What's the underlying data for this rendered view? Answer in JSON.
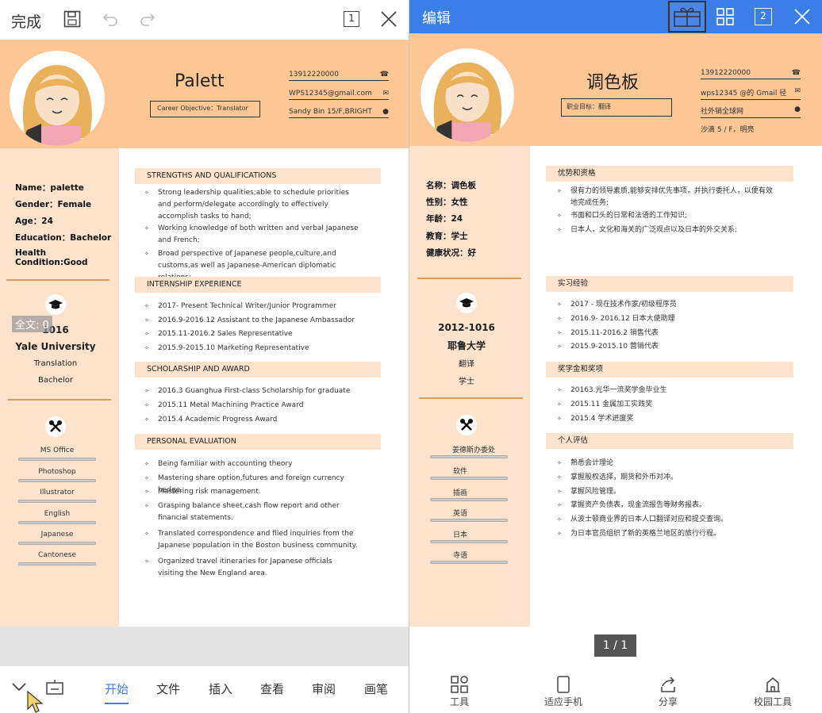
{
  "left": {
    "toolbar": {
      "done": "完成",
      "page_badge": "1"
    },
    "resume": {
      "name": "Palett",
      "objective": "Career Objective：Translator",
      "phone": "13912220000",
      "email": "WPS12345@gmail.com",
      "address": "Sandy Bin 15/F,BRIGHT",
      "info": [
        "Name：palette",
        "Gender：Female",
        "Age：24",
        "Education：Bachelor",
        "Health Condition:Good"
      ],
      "edu": {
        "years": "1016",
        "school": "Yale University",
        "major": "Translation",
        "degree": "Bachelor"
      },
      "skills": [
        "MS Office",
        "Photoshop",
        "Illustrator",
        "English",
        "Japanese",
        "Cantonese"
      ],
      "sections": [
        {
          "title": "STRENGTHS AND QUALIFICATIONS",
          "items": [
            "Strong leadership qualities;able to schedule priorities and perform/delegate accordingly to effectively accomplish tasks to hand;",
            "Working knowledge of both written and verbal Japanese and French;",
            "Broad perspective of Japanese people,culture,and customs,as well as Japanese-American diplomatic relations;"
          ]
        },
        {
          "title": "INTERNSHIP EXPERIENCE",
          "items": [
            "2017- Present    Technical Writer/Junior Programmer",
            "2016.9-2016.12    Assistant to the Japanese Ambassador",
            "2015.11-2016.2    Sales Representative",
            "2015.9-2015.10    Marketing Representative"
          ]
        },
        {
          "title": "SCHOLARSHIP AND AWARD",
          "items": [
            "2016.3 Guanghua First-class Scholarship for graduate",
            "2015.11 Metal Machining Practice Award",
            "2015.4 Academic Progress Award"
          ]
        },
        {
          "title": "PERSONAL EVALUATION",
          "items": [
            "Being familiar with accounting theory",
            "Mastering share option,futures and foreign currency hedge.",
            "Mastering risk management.",
            "Grasping balance sheet,cash flow report and other financial statements.",
            "Translated correspondence and filed inquiries from the Japanese population in the Boston business community.",
            "Organized travel itineraries for Japanese officials visiting the New England area."
          ]
        }
      ]
    },
    "fulltext": "全文: 0",
    "tabs": [
      "开始",
      "文件",
      "插入",
      "查看",
      "审阅",
      "画笔"
    ]
  },
  "right": {
    "toolbar": {
      "edit": "编辑",
      "page_badge": "2"
    },
    "resume": {
      "name": "调色板",
      "objective": "职业目标：翻译",
      "phone": "13912220000",
      "email": "wps12345 @的 Gmail 径",
      "address1": "社外销全球网",
      "address2": "沙滴 5 / F，明亮",
      "info": [
        "名称：调色板",
        "性别：女性",
        "年龄：24",
        "教育：学士",
        "健康状况：好"
      ],
      "edu": {
        "years": "2012-1016",
        "school": "耶鲁大学",
        "major": "翻译",
        "degree": "学士"
      },
      "skills": [
        "姜德斯办委处",
        "软件",
        "插画",
        "英语",
        "日本",
        "寺语"
      ],
      "sections": [
        {
          "title": "优势和资格",
          "items": [
            "很有力的领导素质,能够安排优先事项，并执行委托人，以便有效地完成任务;",
            "书面和口头的日常和法语的工作知识;",
            "日本人，文化和海关的广泛观点以及日本的外交关系;"
          ]
        },
        {
          "title": "实习经验",
          "items": [
            "2017 - 现在技术作家/初级程序员",
            "2016.9- 2016.12 日本大使助理",
            "2015.11-2016.2 销售代表",
            "2015.9-2015.10 营销代表"
          ]
        },
        {
          "title": "奖学金和奖项",
          "items": [
            "20163.光华一流奖学金毕业生",
            "2015.11 金属加工实践奖",
            "2015.4 学术进度奖"
          ]
        },
        {
          "title": "个人评估",
          "items": [
            "熟悉会计理论",
            "掌握股权选择，期货和外币对冲。",
            "掌握风险管理。",
            "掌握资产负债表，现金流报告等财务报表。",
            "从波士顿商业界的日本人口翻译对应和提交查询。",
            "为日本官员组织了新的英格兰地区的旅行行程。"
          ]
        }
      ]
    },
    "pager": "1 / 1",
    "tabs": [
      "工具",
      "适应手机",
      "分享",
      "校园工具"
    ]
  }
}
